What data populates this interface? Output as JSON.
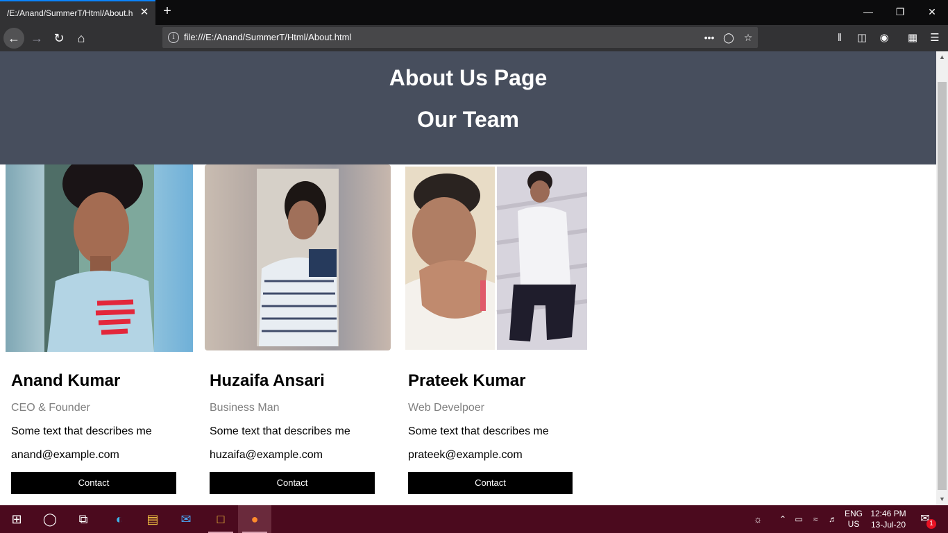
{
  "browser": {
    "tab_title": "/E:/Anand/SummerT/Html/About.h",
    "url": "file:///E:/Anand/SummerT/Html/About.html"
  },
  "page": {
    "about_title": "About Us Page",
    "team_title": "Our Team",
    "members": [
      {
        "name": "Anand Kumar",
        "role": "CEO & Founder",
        "description": "Some text that describes me",
        "email": "anand@example.com",
        "button": "Contact"
      },
      {
        "name": "Huzaifa Ansari",
        "role": "Business Man",
        "description": "Some text that describes me",
        "email": "huzaifa@example.com",
        "button": "Contact"
      },
      {
        "name": "Prateek Kumar",
        "role": "Web Develpoer",
        "description": "Some text that describes me",
        "email": "prateek@example.com",
        "button": "Contact"
      }
    ]
  },
  "taskbar": {
    "lang_top": "ENG",
    "lang_bottom": "US",
    "time": "12:46 PM",
    "date": "13-Jul-20",
    "notification_count": "1"
  },
  "colors": {
    "header_bg": "#474e5d",
    "button_bg": "#000000",
    "taskbar_bg": "#4b0a1e"
  }
}
